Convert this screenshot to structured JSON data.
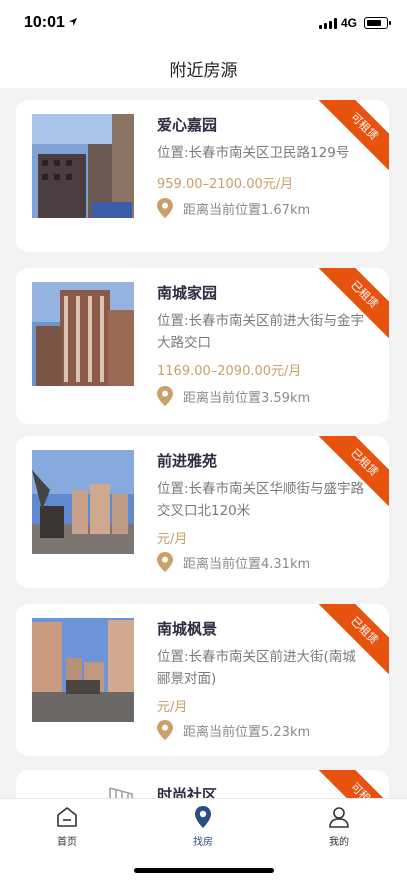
{
  "status_bar": {
    "time": "10:01",
    "network": "4G"
  },
  "header": {
    "title": "附近房源"
  },
  "listings": [
    {
      "name": "爱心嘉园",
      "address": "位置:长春市南关区卫民路129号",
      "price": "959.00–2100.00元/月",
      "distance": "距离当前位置1.67km",
      "badge": "可租赁",
      "badge_color": "#e8520f"
    },
    {
      "name": "南城家园",
      "address": "位置:长春市南关区前进大街与金宇大路交口",
      "price": "1169.00–2090.00元/月",
      "distance": "距离当前位置3.59km",
      "badge": "已租赁",
      "badge_color": "#e8520f"
    },
    {
      "name": "前进雅苑",
      "address": "位置:长春市南关区华顺街与盛宇路交叉口北120米",
      "price": "元/月",
      "distance": "距离当前位置4.31km",
      "badge": "已租赁",
      "badge_color": "#e8520f"
    },
    {
      "name": "南城枫景",
      "address": "位置:长春市南关区前进大街(南城郦景对面)",
      "price": "元/月",
      "distance": "距离当前位置5.23km",
      "badge": "已租赁",
      "badge_color": "#e8520f"
    },
    {
      "name": "时尚社区",
      "address": "",
      "price": "",
      "distance": "",
      "badge": "可租赁",
      "badge_color": "#e8520f"
    }
  ],
  "tabs": [
    {
      "label": "首页",
      "icon": "home-icon"
    },
    {
      "label": "找房",
      "icon": "location-pin-icon",
      "active": true
    },
    {
      "label": "我的",
      "icon": "user-icon"
    }
  ],
  "colors": {
    "accent": "#2a4d86",
    "price": "#c9a06a",
    "badge": "#e8520f"
  }
}
